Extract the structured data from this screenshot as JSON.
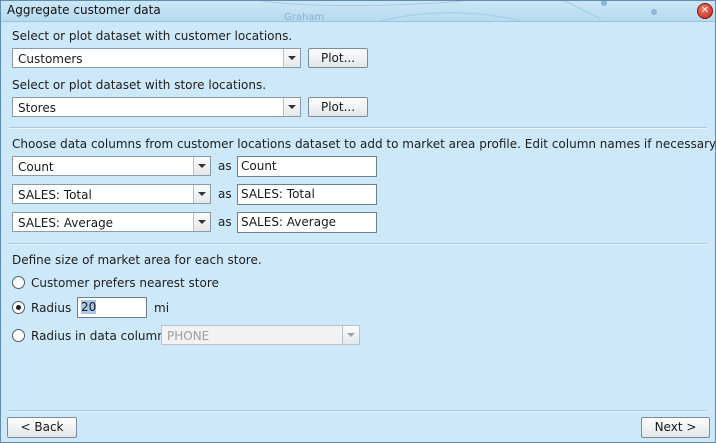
{
  "window": {
    "title": "Aggregate customer data",
    "close_icon": "close-icon"
  },
  "background": {
    "map_label": "Graham"
  },
  "customer_locations": {
    "label": "Select or plot dataset with customer locations.",
    "selected": "Customers",
    "plot_label": "Plot..."
  },
  "store_locations": {
    "label": "Select or plot dataset with store locations.",
    "selected": "Stores",
    "plot_label": "Plot..."
  },
  "columns": {
    "label": "Choose data columns from customer locations dataset to add to market area profile. Edit column names if necessary.",
    "as_label": "as",
    "rows": [
      {
        "column": "Count",
        "name": "Count"
      },
      {
        "column": "SALES: Total",
        "name": "SALES: Total"
      },
      {
        "column": "SALES: Average",
        "name": "SALES: Average"
      }
    ]
  },
  "market_area": {
    "label": "Define size of market area for each store.",
    "options": {
      "nearest": "Customer prefers nearest store",
      "radius": "Radius",
      "radius_column": "Radius in data column"
    },
    "selected_option": "radius",
    "radius_value": "20",
    "radius_unit": "mi",
    "data_column": "PHONE"
  },
  "footer": {
    "back_label": "< Back",
    "next_label": "Next >"
  },
  "colors": {
    "dialog_bg": "#cde8f8",
    "close": "#c0241a",
    "selection": "#a9c7e6"
  }
}
